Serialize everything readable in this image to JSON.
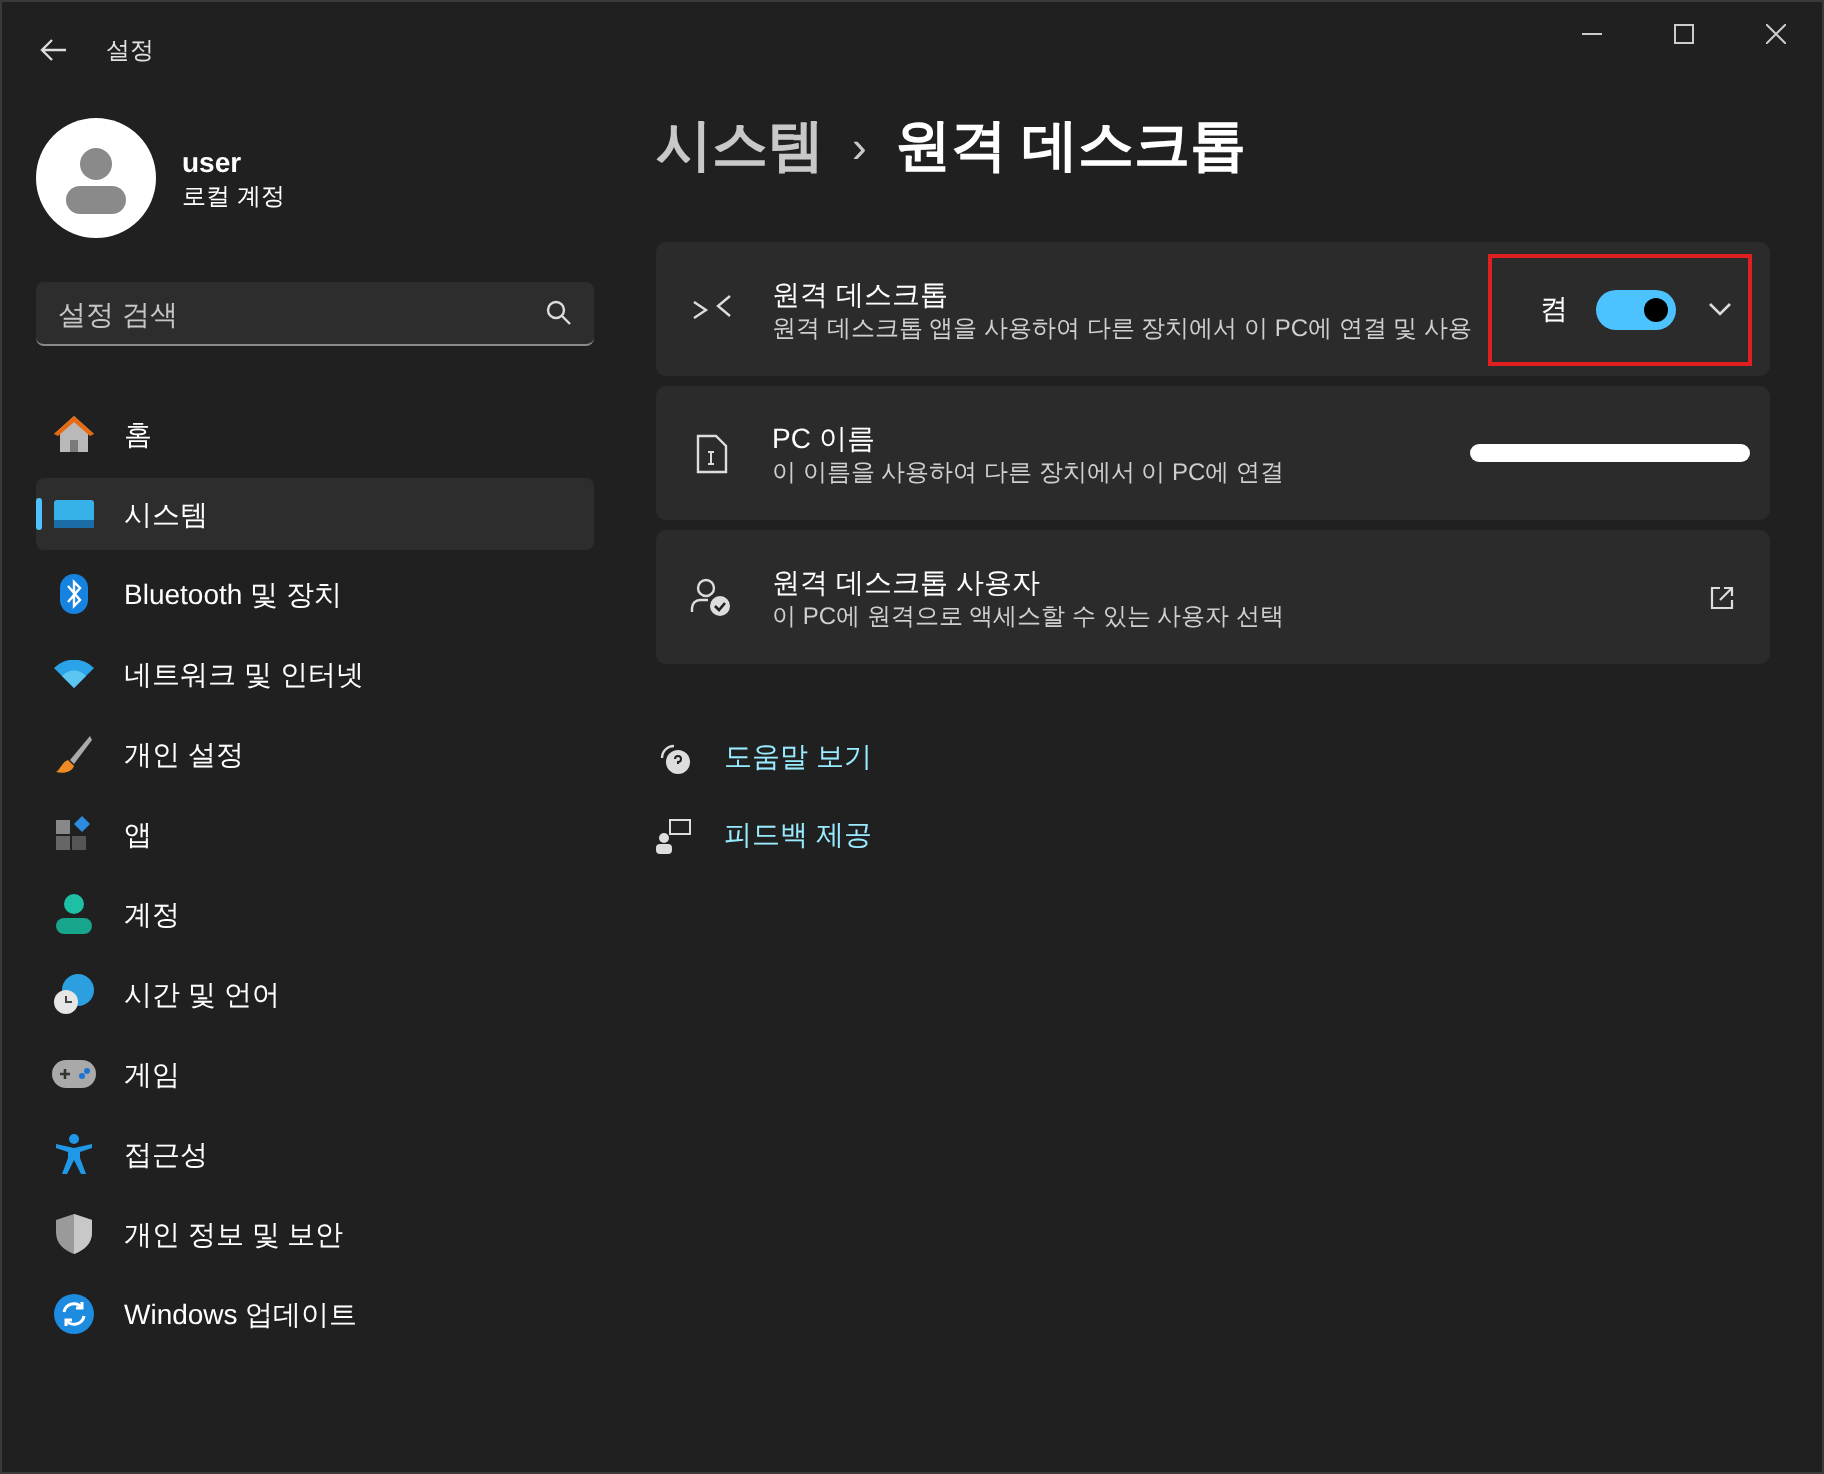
{
  "window": {
    "title": "설정"
  },
  "account": {
    "name": "user",
    "type": "로컬 계정"
  },
  "search": {
    "placeholder": "설정 검색"
  },
  "nav": [
    {
      "kind": "home",
      "label": "홈",
      "selected": false
    },
    {
      "kind": "system",
      "label": "시스템",
      "selected": true
    },
    {
      "kind": "bluetooth",
      "label": "Bluetooth 및 장치",
      "selected": false
    },
    {
      "kind": "network",
      "label": "네트워크 및 인터넷",
      "selected": false
    },
    {
      "kind": "personalize",
      "label": "개인 설정",
      "selected": false
    },
    {
      "kind": "apps",
      "label": "앱",
      "selected": false
    },
    {
      "kind": "accounts",
      "label": "계정",
      "selected": false
    },
    {
      "kind": "time",
      "label": "시간 및 언어",
      "selected": false
    },
    {
      "kind": "gaming",
      "label": "게임",
      "selected": false
    },
    {
      "kind": "accessibility",
      "label": "접근성",
      "selected": false
    },
    {
      "kind": "privacy",
      "label": "개인 정보 및 보안",
      "selected": false
    },
    {
      "kind": "update",
      "label": "Windows 업데이트",
      "selected": false
    }
  ],
  "breadcrumb": {
    "parent": "시스템",
    "separator": "›",
    "current": "원격 데스크톱"
  },
  "cards": [
    {
      "kind": "toggle",
      "title": "원격 데스크톱",
      "subtitle": "원격 데스크톱 앱을 사용하여 다른 장치에서 이 PC에 연결 및 사용",
      "state_label": "켬",
      "on": true,
      "highlighted": true
    },
    {
      "kind": "value",
      "title": "PC 이름",
      "subtitle": "이 이름을 사용하여 다른 장치에서 이 PC에 연결",
      "redacted": true
    },
    {
      "kind": "link",
      "title": "원격 데스크톱 사용자",
      "subtitle": "이 PC에 원격으로 액세스할 수 있는 사용자 선택"
    }
  ],
  "help_links": [
    {
      "kind": "help",
      "label": "도움말 보기"
    },
    {
      "kind": "feedback",
      "label": "피드백 제공"
    }
  ]
}
